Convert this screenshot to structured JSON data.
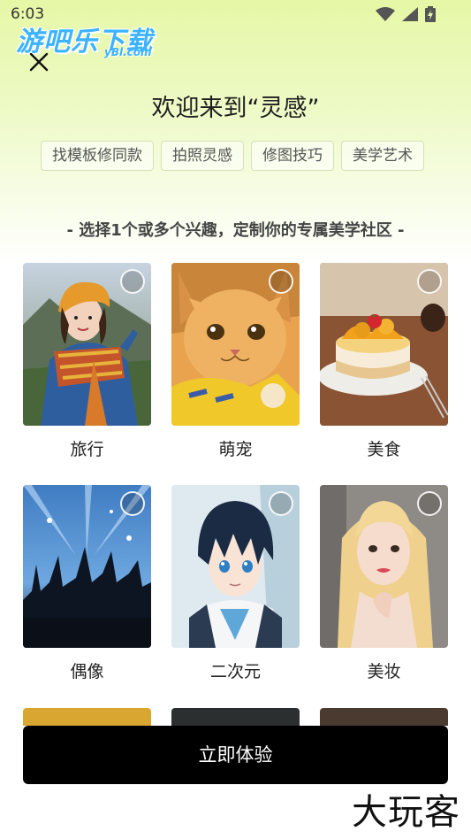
{
  "status": {
    "time": "6:03"
  },
  "watermark": {
    "title": "游吧乐下载",
    "sub": "yBl.com"
  },
  "header": {
    "title": "欢迎来到“灵感”"
  },
  "tags": [
    "找模板修同款",
    "拍照灵感",
    "修图技巧",
    "美学艺术"
  ],
  "subtitle": "- 选择1个或多个兴趣，定制你的专属美学社区 -",
  "interests": [
    {
      "label": "旅行",
      "icon": "travel-photo"
    },
    {
      "label": "萌宠",
      "icon": "pet-cat-photo"
    },
    {
      "label": "美食",
      "icon": "dessert-photo"
    },
    {
      "label": "偶像",
      "icon": "concert-photo"
    },
    {
      "label": "二次元",
      "icon": "anime-boy-photo"
    },
    {
      "label": "美妆",
      "icon": "makeup-portrait-photo"
    }
  ],
  "cta": {
    "label": "立即体验"
  },
  "brand": {
    "text": "大玩客"
  },
  "colors": {
    "accent": "#000000",
    "header_gradient": "#e6f7a6"
  }
}
